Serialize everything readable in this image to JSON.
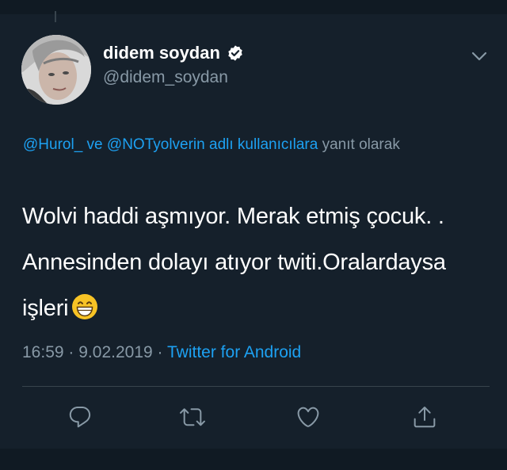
{
  "user": {
    "display_name": "didem soydan",
    "handle": "@didem_soydan",
    "verified": true,
    "avatar": "profile-photo"
  },
  "reply_context": {
    "mention1": "@Hurol_",
    "connector": "ve",
    "mention2": "@NOTyolverin",
    "suffix_link": "adlı kullanıcılara",
    "suffix_text": "yanıt olarak"
  },
  "tweet": {
    "text": "Wolvi haddi aşmıyor. Merak etmiş çocuk. . Annesinden dolayı atıyor twiti.Oralardaysa işleri",
    "emoji": "grinning-face-emoji"
  },
  "meta": {
    "time": "16:59",
    "date": "9.02.2019",
    "separator": "·",
    "source": "Twitter for Android"
  },
  "actions": {
    "reply_icon": "reply-icon",
    "retweet_icon": "retweet-icon",
    "like_icon": "like-icon",
    "share_icon": "share-icon"
  },
  "colors": {
    "background": "#15202b",
    "accent": "#1da1f2",
    "secondary_text": "#8899a6",
    "divider": "#38444d"
  }
}
